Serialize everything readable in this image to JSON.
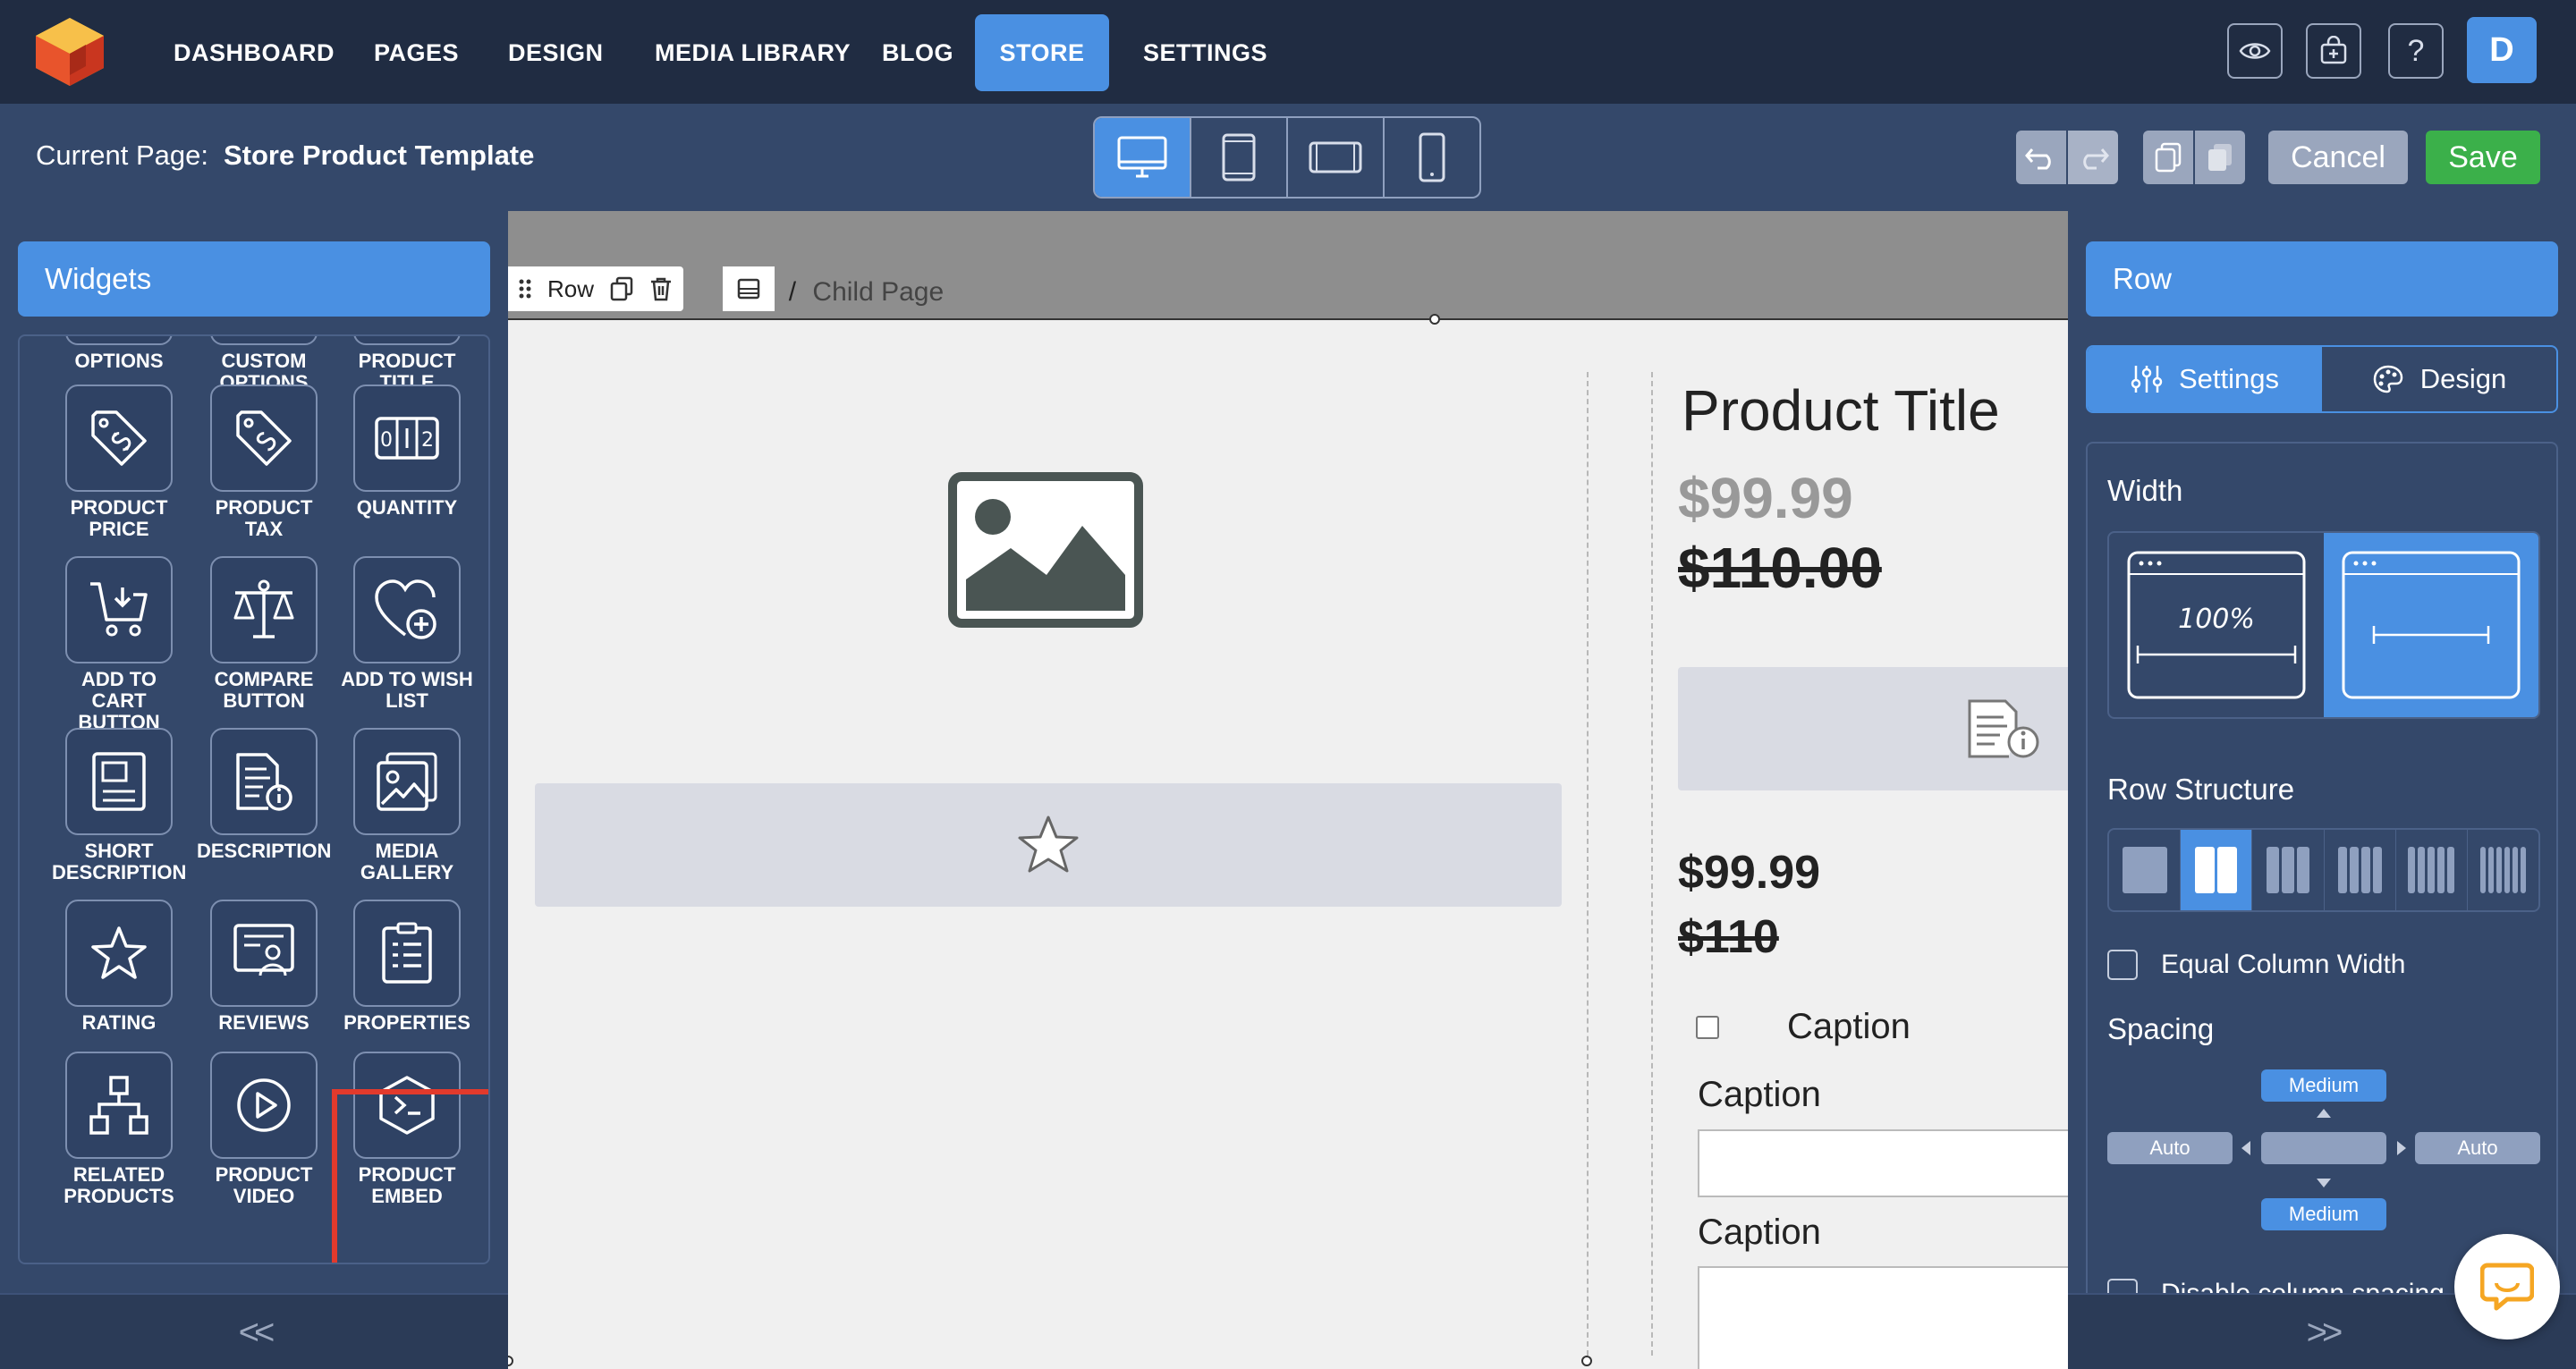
{
  "nav": {
    "items": [
      "DASHBOARD",
      "PAGES",
      "DESIGN",
      "MEDIA LIBRARY",
      "BLOG",
      "STORE",
      "SETTINGS"
    ],
    "active": "STORE",
    "avatar_letter": "D",
    "help_label": "?"
  },
  "subbar": {
    "current_page_label": "Current Page:",
    "current_page_value": "Store Product Template",
    "cancel_label": "Cancel",
    "save_label": "Save"
  },
  "widgets": {
    "header": "Widgets",
    "partial_top": [
      "OPTIONS",
      "CUSTOM OPTIONS",
      "PRODUCT TITLE"
    ],
    "items": [
      {
        "label": "PRODUCT PRICE",
        "icon": "price-tag-icon"
      },
      {
        "label": "PRODUCT TAX",
        "icon": "tax-tag-icon"
      },
      {
        "label": "QUANTITY",
        "icon": "quantity-counter-icon"
      },
      {
        "label": "ADD TO CART BUTTON",
        "icon": "cart-icon"
      },
      {
        "label": "COMPARE BUTTON",
        "icon": "scale-icon"
      },
      {
        "label": "ADD TO WISH LIST",
        "icon": "heart-plus-icon"
      },
      {
        "label": "SHORT DESCRIPTION",
        "icon": "short-description-icon"
      },
      {
        "label": "DESCRIPTION",
        "icon": "description-icon"
      },
      {
        "label": "MEDIA GALLERY",
        "icon": "media-gallery-icon"
      },
      {
        "label": "RATING",
        "icon": "star-icon"
      },
      {
        "label": "REVIEWS",
        "icon": "reviews-icon"
      },
      {
        "label": "PROPERTIES",
        "icon": "properties-icon"
      },
      {
        "label": "RELATED PRODUCTS",
        "icon": "related-products-icon"
      },
      {
        "label": "PRODUCT VIDEO",
        "icon": "video-icon"
      },
      {
        "label": "PRODUCT EMBED",
        "icon": "embed-icon"
      }
    ],
    "highlighted": "MEDIA GALLERY",
    "collapse_label": "<<"
  },
  "canvas": {
    "row_label": "Row",
    "breadcrumb_partial": "ge",
    "breadcrumb_sep": "/",
    "breadcrumb_child": "Child Page",
    "product_title": "Product Title",
    "price": "$99.99",
    "old_price": "$110.00",
    "price_small": "$99.99",
    "old_price_small": "$110",
    "checkbox_caption": "Caption",
    "caption_1": "Caption",
    "caption_2": "Caption"
  },
  "right_panel": {
    "header": "Row",
    "tab_settings": "Settings",
    "tab_design": "Design",
    "width_title": "Width",
    "width_full_label": "100%",
    "row_structure_title": "Row Structure",
    "equal_column_width": "Equal Column Width",
    "spacing_title": "Spacing",
    "spacing_top": "Medium",
    "spacing_bottom": "Medium",
    "spacing_left": "Auto",
    "spacing_right": "Auto",
    "disable_column_spacing": "Disable column spacing",
    "collapse_label": ">>"
  },
  "colors": {
    "accent": "#4a90e2",
    "save": "#3bb04a",
    "highlight": "#e23a2c",
    "navbar": "#202c42",
    "panel": "#34486a"
  }
}
